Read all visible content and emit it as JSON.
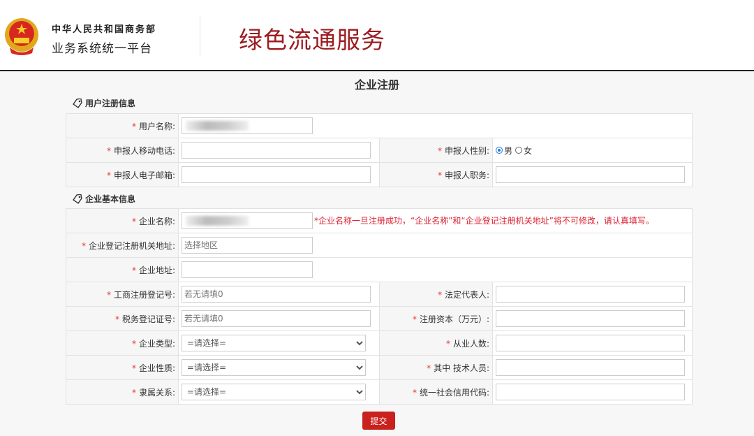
{
  "header": {
    "org_line1": "中华人民共和国商务部",
    "org_line2": "业务系统统一平台",
    "brand": "绿色流通服务"
  },
  "page_title": "企业注册",
  "user_section": {
    "title": "用户注册信息",
    "username_label": "用户名称:",
    "mobile_label": "申报人移动电话:",
    "gender_label": "申报人性别:",
    "gender_male": "男",
    "gender_female": "女",
    "gender_selected": "男",
    "email_label": "申报人电子邮箱:",
    "position_label": "申报人职务:"
  },
  "company_section": {
    "title": "企业基本信息",
    "name_label": "企业名称:",
    "name_note": "*企业名称一旦注册成功，“企业名称”和“企业登记注册机关地址”将不可修改，请认真填写。",
    "reg_addr_label": "企业登记注册机关地址:",
    "reg_addr_placeholder": "选择地区",
    "address_label": "企业地址:",
    "biz_reg_label": "工商注册登记号:",
    "biz_reg_placeholder": "若无请填0",
    "legal_rep_label": "法定代表人:",
    "tax_label": "税务登记证号:",
    "tax_placeholder": "若无请填0",
    "capital_label": "注册资本（万元）:",
    "type_label": "企业类型:",
    "type_value": "=请选择=",
    "employees_label": "从业人数:",
    "nature_label": "企业性质:",
    "nature_value": "=请选择=",
    "tech_label": "其中 技术人员:",
    "affil_label": "隶属关系:",
    "affil_value": "=请选择=",
    "credit_label": "统一社会信用代码:"
  },
  "submit_label": "提交",
  "required_mark": "*"
}
